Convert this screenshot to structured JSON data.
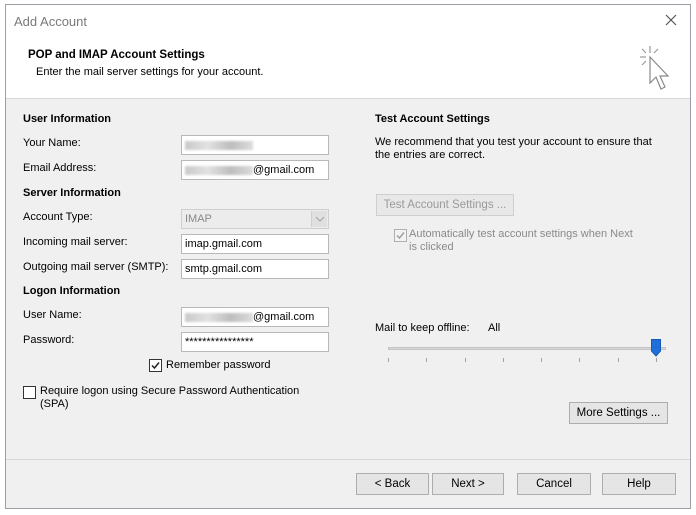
{
  "window": {
    "title": "Add Account"
  },
  "header": {
    "title": "POP and IMAP Account Settings",
    "subtitle": "Enter the mail server settings for your account."
  },
  "user_info": {
    "section": "User Information",
    "name_label": "Your Name:",
    "email_label": "Email Address:",
    "email_suffix": "@gmail.com"
  },
  "server_info": {
    "section": "Server Information",
    "account_type_label": "Account Type:",
    "account_type_value": "IMAP",
    "incoming_label": "Incoming mail server:",
    "incoming_value": "imap.gmail.com",
    "outgoing_label": "Outgoing mail server (SMTP):",
    "outgoing_value": "smtp.gmail.com"
  },
  "logon_info": {
    "section": "Logon Information",
    "username_label": "User Name:",
    "username_suffix": "@gmail.com",
    "password_label": "Password:",
    "password_value": "****************",
    "remember_label": "Remember password",
    "remember_checked": true,
    "spa_label_line1": "Require logon using Secure Password Authentication",
    "spa_label_line2": "(SPA)",
    "spa_checked": false
  },
  "test_settings": {
    "section": "Test Account Settings",
    "desc_line1": "We recommend that you test your account to ensure that",
    "desc_line2": "the entries are correct.",
    "test_button": "Test Account Settings ...",
    "auto_test_line1": "Automatically test account settings when Next",
    "auto_test_line2": "is clicked",
    "auto_test_checked": true
  },
  "offline": {
    "label": "Mail to keep offline:",
    "value": "All",
    "slider_fraction": 1.0,
    "tick_count": 8
  },
  "buttons": {
    "more_settings": "More Settings ...",
    "back": "< Back",
    "next": "Next >",
    "cancel": "Cancel",
    "help": "Help"
  },
  "colors": {
    "accent": "#1e6fd9",
    "disabled_text": "#9a9a9a"
  }
}
